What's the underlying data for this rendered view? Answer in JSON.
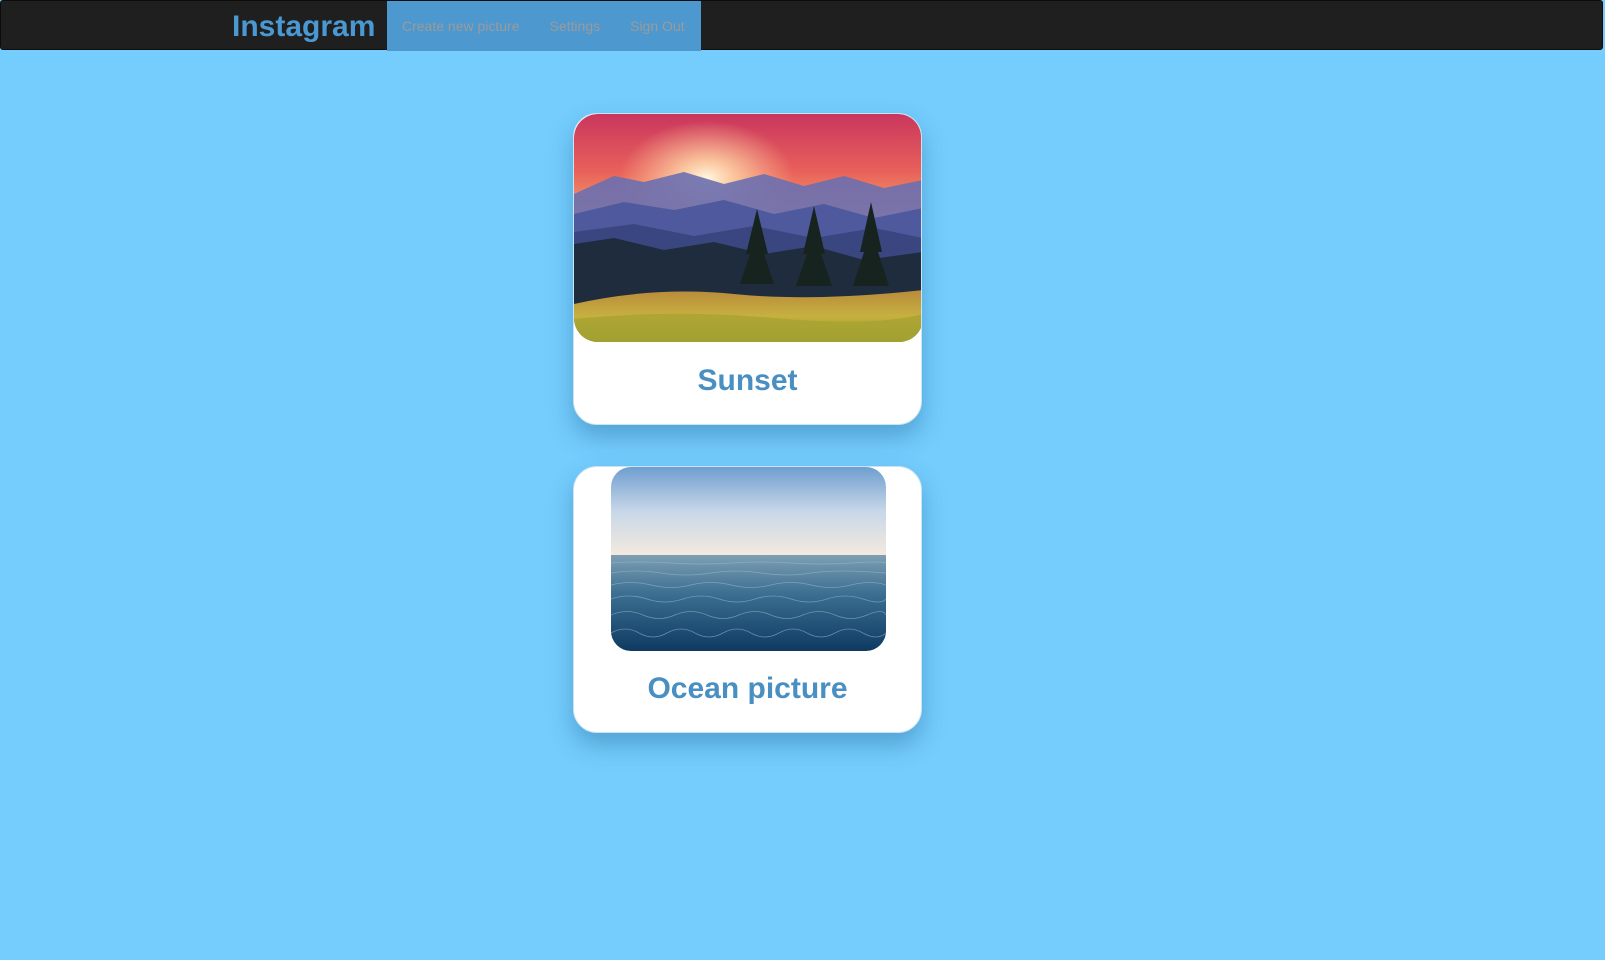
{
  "navbar": {
    "brand": "Instagram",
    "links": [
      {
        "label": "Create new picture"
      },
      {
        "label": "Settings"
      },
      {
        "label": "Sign Out"
      }
    ]
  },
  "posts": [
    {
      "title": "Sunset",
      "image": "mountain-sunset-photo"
    },
    {
      "title": "Ocean picture",
      "image": "ocean-horizon-photo"
    }
  ],
  "colors": {
    "page_background": "#74cdfd",
    "navbar_background": "#1f1f1f",
    "nav_group_background": "#4c98cf",
    "brand_text": "#4a99d3",
    "nav_link_text": "#9b9b9b",
    "card_title_text": "#4a8fc2"
  }
}
